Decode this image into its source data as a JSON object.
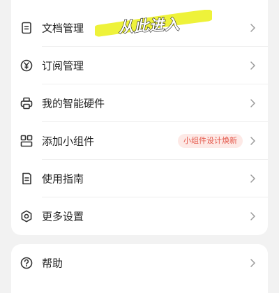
{
  "menu": {
    "items": [
      {
        "label": "文档管理",
        "icon": "document-icon"
      },
      {
        "label": "订阅管理",
        "icon": "yen-circle-icon"
      },
      {
        "label": "我的智能硬件",
        "icon": "printer-icon"
      },
      {
        "label": "添加小组件",
        "icon": "widgets-grid-icon",
        "badge": "小组件设计焕新"
      },
      {
        "label": "使用指南",
        "icon": "guide-book-icon"
      },
      {
        "label": "更多设置",
        "icon": "settings-gear-icon"
      }
    ]
  },
  "help": {
    "label": "帮助",
    "icon": "question-circle-icon"
  },
  "annotation": {
    "text": "从此进入",
    "highlight_color": "#eef23a"
  },
  "colors": {
    "background": "#f2f2f2",
    "card": "#ffffff",
    "text": "#222222",
    "chevron": "#9a9a9a",
    "badge_bg": "#fde9e6",
    "badge_text": "#e4574a"
  }
}
